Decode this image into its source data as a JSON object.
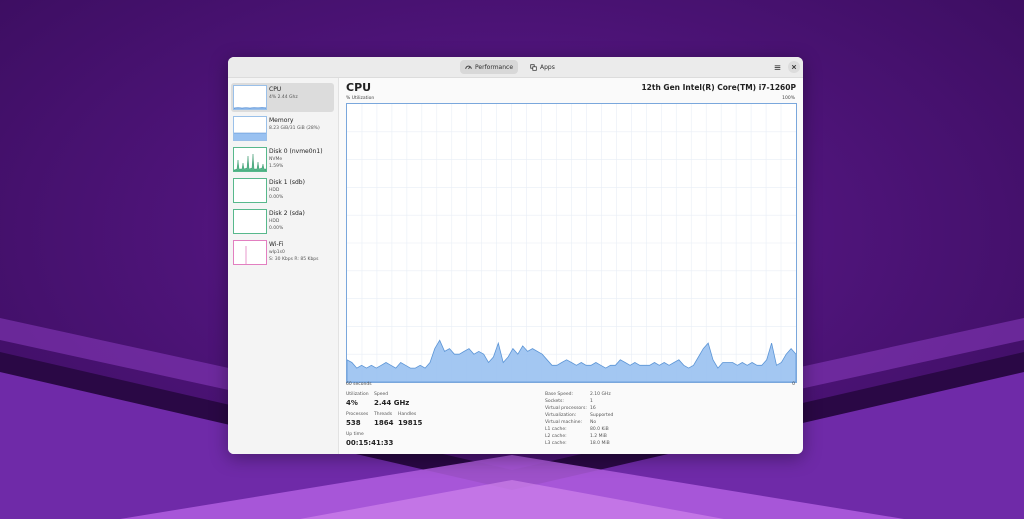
{
  "header": {
    "tabs": [
      {
        "label": "Performance",
        "icon": "gauge-icon",
        "active": true
      },
      {
        "label": "Apps",
        "icon": "apps-icon",
        "active": false
      }
    ],
    "menu_icon": "hamburger-menu-icon",
    "close_icon": "close-icon"
  },
  "sidebar": {
    "items": [
      {
        "title": "CPU",
        "sub": "4% 2.44 Ghz",
        "sub2": ""
      },
      {
        "title": "Memory",
        "sub": "8.23 GiB/31 GiB (28%)",
        "sub2": ""
      },
      {
        "title": "Disk 0 (nvme0n1)",
        "sub": "NVMe",
        "sub2": "1.59%"
      },
      {
        "title": "Disk 1 (sdb)",
        "sub": "HDD",
        "sub2": "0.00%"
      },
      {
        "title": "Disk 2 (sda)",
        "sub": "HDD",
        "sub2": "0.00%"
      },
      {
        "title": "Wi-Fi",
        "sub": "wlp1s0",
        "sub2": "S: 30 Kbps R: 85 Kbps"
      }
    ]
  },
  "main": {
    "title": "CPU",
    "model": "12th Gen Intel(R) Core(TM) i7-1260P",
    "graph": {
      "y_label": "% Utilization",
      "y_max_label": "100%",
      "x_left_label": "60 seconds",
      "x_right_label": "0",
      "utilization_series": [
        8,
        7,
        5,
        6,
        5,
        6,
        5,
        6,
        7,
        6,
        5,
        7,
        6,
        5,
        5,
        6,
        5,
        7,
        12,
        15,
        11,
        12,
        10,
        10,
        11,
        12,
        10,
        11,
        10,
        7,
        9,
        14,
        7,
        9,
        12,
        10,
        13,
        11,
        12,
        11,
        10,
        8,
        6,
        6,
        7,
        8,
        7,
        6,
        7,
        6,
        6,
        7,
        6,
        5,
        6,
        6,
        8,
        7,
        6,
        7,
        6,
        6,
        6,
        7,
        6,
        7,
        6,
        7,
        8,
        6,
        5,
        6,
        9,
        12,
        14,
        8,
        5,
        7,
        7,
        7,
        6,
        7,
        6,
        7,
        6,
        6,
        8,
        14,
        6,
        7,
        10,
        12,
        10
      ]
    },
    "stats": {
      "utilization": {
        "label": "Utilization",
        "value": "4%"
      },
      "speed": {
        "label": "Speed",
        "value": "2.44 GHz"
      },
      "processes": {
        "label": "Processes",
        "value": "538"
      },
      "threads": {
        "label": "Threads",
        "value": "1864"
      },
      "handles": {
        "label": "Handles",
        "value": "19815"
      },
      "uptime": {
        "label": "Up time",
        "value": "00:15:41:33"
      }
    },
    "details": [
      {
        "key": "Base Speed:",
        "value": "2.10 GHz"
      },
      {
        "key": "Sockets:",
        "value": "1"
      },
      {
        "key": "Virtual processors:",
        "value": "16"
      },
      {
        "key": "Virtualization:",
        "value": "Supported"
      },
      {
        "key": "Virtual machine:",
        "value": "No"
      },
      {
        "key": "L1 cache:",
        "value": "80.0 KiB"
      },
      {
        "key": "L2 cache:",
        "value": "1.2 MiB"
      },
      {
        "key": "L3 cache:",
        "value": "18.0 MiB"
      }
    ]
  },
  "colors": {
    "accent_blue": "#7aa7dc",
    "fill_blue": "#99c1f1",
    "disk_green": "#57b88c",
    "wifi_pink": "#e27fc0",
    "background_purple": "#4e1479"
  }
}
